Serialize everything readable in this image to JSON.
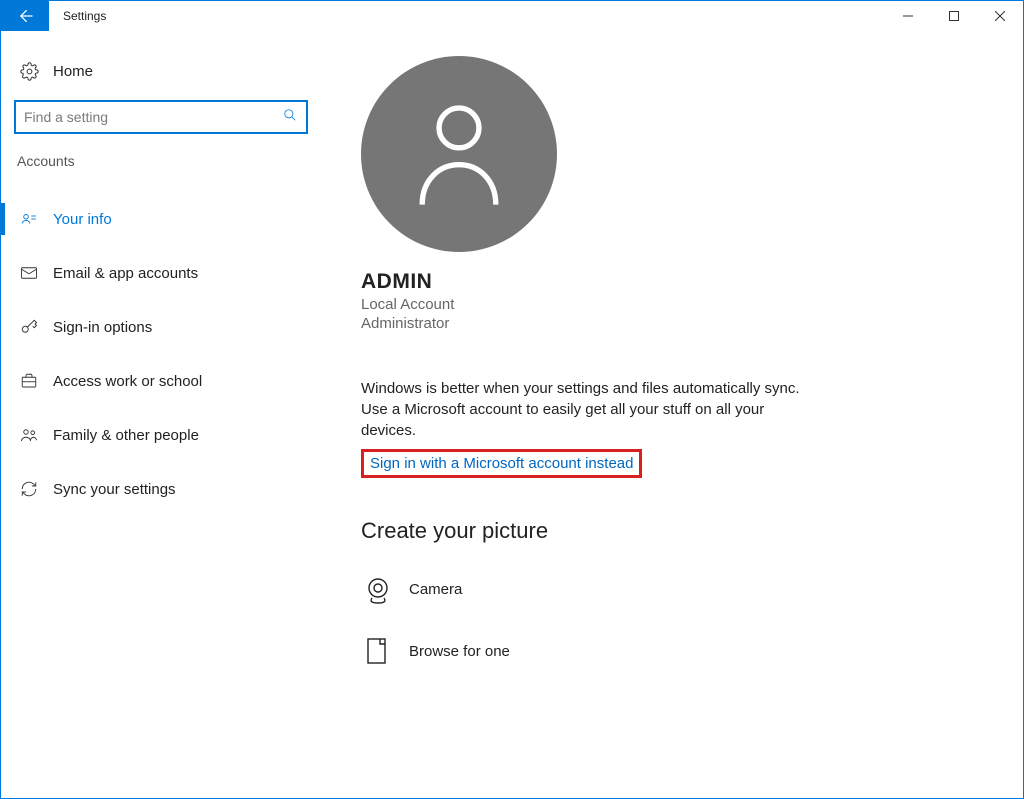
{
  "window": {
    "title": "Settings"
  },
  "sidebar": {
    "home": "Home",
    "search_placeholder": "Find a setting",
    "section": "Accounts",
    "items": [
      {
        "label": "Your info"
      },
      {
        "label": "Email & app accounts"
      },
      {
        "label": "Sign-in options"
      },
      {
        "label": "Access work or school"
      },
      {
        "label": "Family & other people"
      },
      {
        "label": "Sync your settings"
      }
    ]
  },
  "profile": {
    "name": "ADMIN",
    "account_type": "Local Account",
    "role": "Administrator",
    "sync_text": "Windows is better when your settings and files automatically sync. Use a Microsoft account to easily get all your stuff on all your devices.",
    "ms_link": "Sign in with a Microsoft account instead",
    "create_heading": "Create your picture",
    "camera": "Camera",
    "browse": "Browse for one"
  }
}
